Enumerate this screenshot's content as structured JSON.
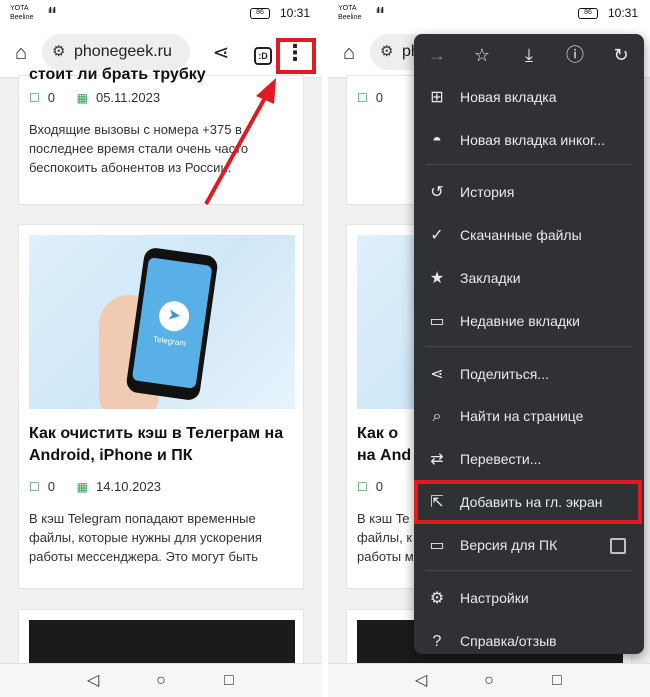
{
  "status": {
    "carrier_line1": "YOTA",
    "carrier_line2": "Beeline",
    "signal": "ıll ıll",
    "battery": "86",
    "time": "10:31"
  },
  "browser": {
    "url": "phonegeek.ru",
    "url_partial": "ph",
    "tabs_badge": ":D"
  },
  "articles": {
    "a1": {
      "title_fragment": "стоит ли брать трубку",
      "comments": "0",
      "date": "05.11.2023",
      "excerpt": "Входящие вызовы с номера +375 в последнее время стали очень часто беспокоить абонентов из России."
    },
    "a2": {
      "image_word": "Telegram",
      "title": "Как очистить кэш в Телеграм на Android, iPhone и ПК",
      "title_partial_1": "Как о",
      "title_partial_2": "на And",
      "comments": "0",
      "date": "14.10.2023",
      "excerpt": "В кэш Telegram попадают временные файлы, которые нужны для ускорения работы мессенджера. Это могут быть",
      "excerpt_partial_1": "В кэш Te",
      "excerpt_partial_2": "файлы, к",
      "excerpt_partial_3": "работы м"
    }
  },
  "menu": {
    "top_icons": [
      "forward-icon",
      "star-icon",
      "download-icon",
      "info-icon",
      "refresh-icon"
    ],
    "items": [
      {
        "label": "Новая вкладка",
        "icon": "add-box-icon"
      },
      {
        "label": "Новая вкладка инког...",
        "icon": "incognito-icon"
      },
      {
        "label": "История",
        "icon": "history-icon"
      },
      {
        "label": "Скачанные файлы",
        "icon": "download-done-icon"
      },
      {
        "label": "Закладки",
        "icon": "star-filled-icon"
      },
      {
        "label": "Недавние вкладки",
        "icon": "devices-icon"
      },
      {
        "label": "Поделиться...",
        "icon": "share-icon"
      },
      {
        "label": "Найти на странице",
        "icon": "find-in-page-icon"
      },
      {
        "label": "Перевести...",
        "icon": "translate-icon"
      },
      {
        "label": "Добавить на гл. экран",
        "icon": "add-to-home-icon"
      },
      {
        "label": "Версия для ПК",
        "icon": "desktop-icon"
      },
      {
        "label": "Настройки",
        "icon": "settings-icon"
      },
      {
        "label": "Справка/отзыв",
        "icon": "help-icon"
      }
    ]
  },
  "colors": {
    "highlight_red": "#e01a22",
    "accent_green": "#2ea44f",
    "menu_bg": "#303134"
  }
}
